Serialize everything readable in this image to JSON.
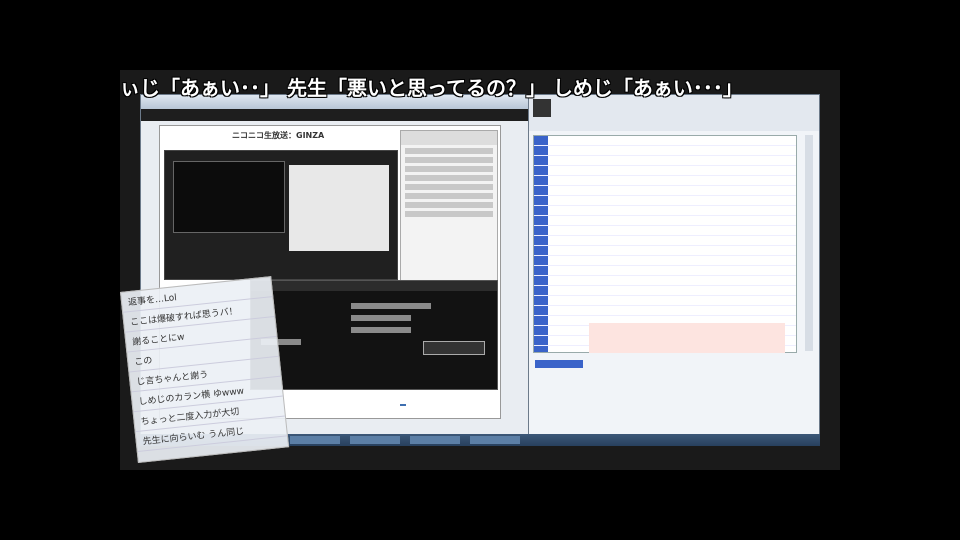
{
  "subtitle": {
    "text": "ぃじ「あぁい･･」 先生「悪いと思ってるの？」 しめじ「あぁい･･･」"
  },
  "browser": {
    "title": "",
    "page_logo": "ニコニコ生放送：GINZA"
  },
  "comment_popup": {
    "lines": [
      "返事を…Lol",
      "ここは爆破すれば思うバ！",
      "謝ることにw",
      "この",
      "じ言ちゃんと謝う",
      "しめじのカラン横 ゆwww",
      "ちょっと二度入力が大切",
      "先生に向らいむ うん同じ"
    ]
  },
  "colors": {
    "viewer_row_accent": "#3a63c9",
    "taskbar": "#2f4a6c",
    "subtitle": "#ffffff"
  }
}
